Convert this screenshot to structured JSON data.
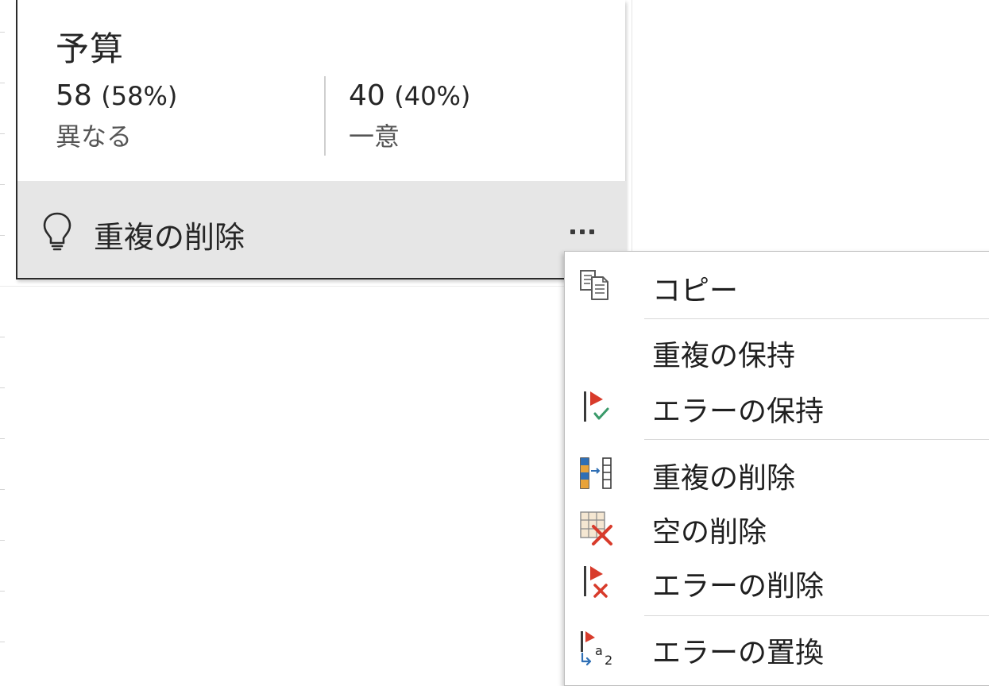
{
  "card": {
    "title": "予算",
    "distinct": {
      "value": "58",
      "percent": "(58%)",
      "label": "異なる"
    },
    "unique": {
      "value": "40",
      "percent": "(40%)",
      "label": "一意"
    },
    "suggestion": {
      "icon": "lightbulb-icon",
      "label": "重複の削除",
      "more_icon": "ellipsis-icon"
    }
  },
  "menu": {
    "items": [
      {
        "label": "コピー",
        "icon": "copy-icon"
      },
      {
        "label": "重複の保持",
        "icon": ""
      },
      {
        "label": "エラーの保持",
        "icon": "keep-errors-icon"
      },
      {
        "label": "重複の削除",
        "icon": "remove-duplicates-icon"
      },
      {
        "label": "空の削除",
        "icon": "remove-empty-icon"
      },
      {
        "label": "エラーの削除",
        "icon": "remove-errors-icon"
      },
      {
        "label": "エラーの置換",
        "icon": "replace-errors-icon"
      }
    ]
  },
  "colors": {
    "flag_red": "#d83b2b",
    "check_green": "#3a9a6a",
    "column_blue": "#2f6fb5",
    "column_orange": "#e8a33a"
  }
}
